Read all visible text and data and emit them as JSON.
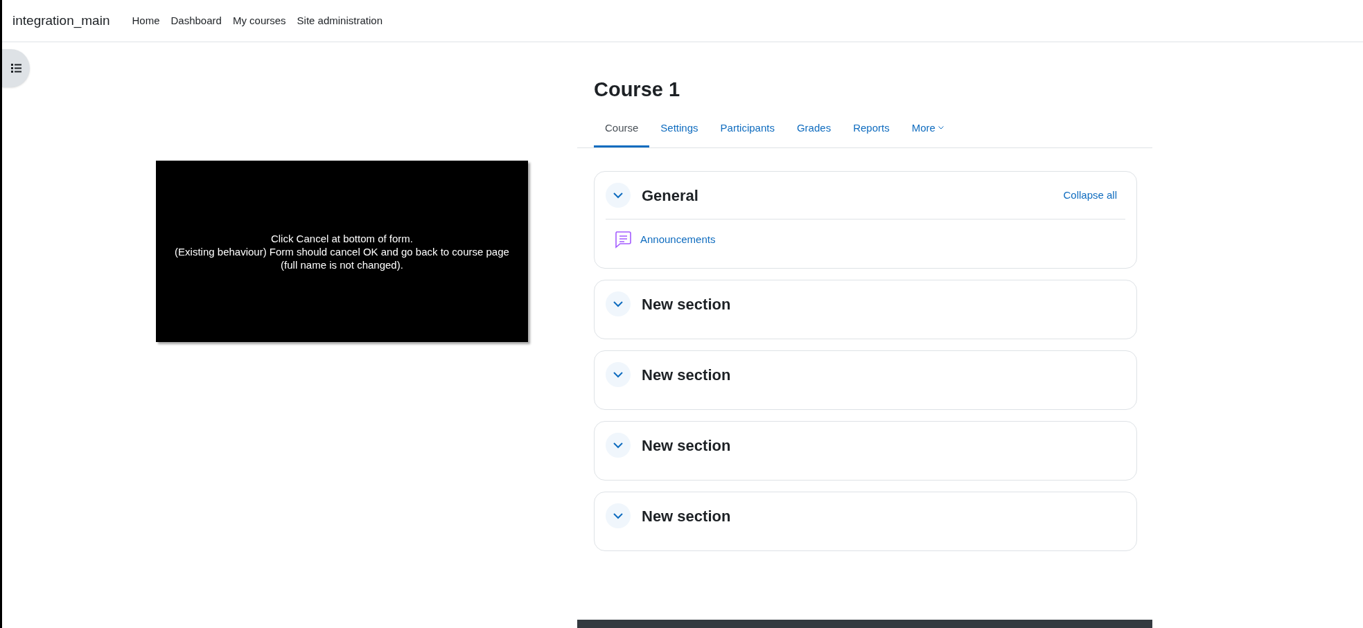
{
  "navbar": {
    "brand": "integration_main",
    "links": [
      {
        "label": "Home",
        "selected": false
      },
      {
        "label": "Dashboard",
        "selected": false
      },
      {
        "label": "My courses",
        "selected": false
      },
      {
        "label": "Site administration",
        "selected": false
      }
    ]
  },
  "course": {
    "title": "Course 1"
  },
  "tabs": [
    {
      "label": "Course",
      "selected": true
    },
    {
      "label": "Settings",
      "selected": false
    },
    {
      "label": "Participants",
      "selected": false
    },
    {
      "label": "Grades",
      "selected": false
    },
    {
      "label": "Reports",
      "selected": false
    },
    {
      "label": "More",
      "selected": false,
      "dropdown": true
    }
  ],
  "sections": [
    {
      "title": "General",
      "expanded": true,
      "collapse_all": "Collapse all",
      "activities": [
        {
          "name": "Announcements",
          "kind": "forum"
        }
      ]
    },
    {
      "title": "New section",
      "expanded": true
    },
    {
      "title": "New section",
      "expanded": true
    },
    {
      "title": "New section",
      "expanded": true
    },
    {
      "title": "New section",
      "expanded": true
    }
  ],
  "overlay_note": {
    "lines": [
      "Click Cancel at bottom of form.",
      "(Existing behaviour) Form should cancel OK and go back to course page",
      "(full name is not changed)."
    ]
  }
}
